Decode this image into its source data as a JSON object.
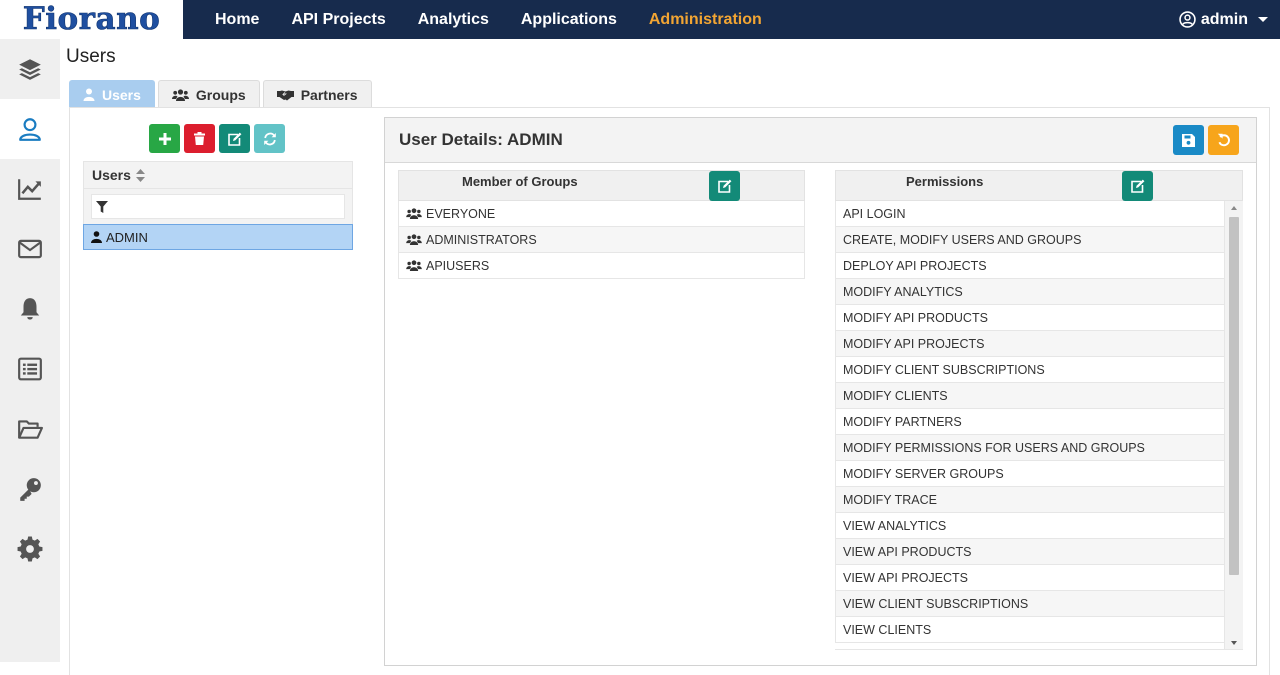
{
  "brand": {
    "logo_text": "Fiorano"
  },
  "nav": {
    "items": [
      {
        "label": "Home"
      },
      {
        "label": "API Projects"
      },
      {
        "label": "Analytics"
      },
      {
        "label": "Applications"
      },
      {
        "label": "Administration"
      }
    ],
    "active_color": "#f2a533",
    "user_label": "admin"
  },
  "sidebar": {
    "items": [
      {
        "icon": "layers-icon"
      },
      {
        "icon": "user-icon"
      },
      {
        "icon": "chart-line-icon"
      },
      {
        "icon": "envelope-icon"
      },
      {
        "icon": "bell-icon"
      },
      {
        "icon": "list-icon"
      },
      {
        "icon": "folder-open-icon"
      },
      {
        "icon": "key-icon"
      },
      {
        "icon": "gear-icon"
      }
    ]
  },
  "page": {
    "title": "Users"
  },
  "tabs": [
    {
      "label": "Users"
    },
    {
      "label": "Groups"
    },
    {
      "label": "Partners"
    }
  ],
  "users_panel": {
    "header": "Users",
    "filter_placeholder": "",
    "rows": [
      {
        "name": "ADMIN"
      }
    ]
  },
  "details": {
    "title": "User Details: ADMIN",
    "groups_header": "Member of Groups",
    "groups": [
      "EVERYONE",
      "ADMINISTRATORS",
      "APIUSERS"
    ],
    "permissions_header": "Permissions",
    "permissions": [
      "API LOGIN",
      "CREATE, MODIFY USERS AND GROUPS",
      "DEPLOY API PROJECTS",
      "MODIFY ANALYTICS",
      "MODIFY API PRODUCTS",
      "MODIFY API PROJECTS",
      "MODIFY CLIENT SUBSCRIPTIONS",
      "MODIFY CLIENTS",
      "MODIFY PARTNERS",
      "MODIFY PERMISSIONS FOR USERS AND GROUPS",
      "MODIFY SERVER GROUPS",
      "MODIFY TRACE",
      "VIEW ANALYTICS",
      "VIEW API PRODUCTS",
      "VIEW API PROJECTS",
      "VIEW CLIENT SUBSCRIPTIONS",
      "VIEW CLIENTS"
    ]
  },
  "colors": {
    "topbar": "#172b4d",
    "add": "#28a745",
    "delete": "#dc1e2e",
    "edit": "#138a78",
    "refresh": "#62c3c7",
    "save": "#1a8ac6",
    "reset": "#f7a51b"
  }
}
